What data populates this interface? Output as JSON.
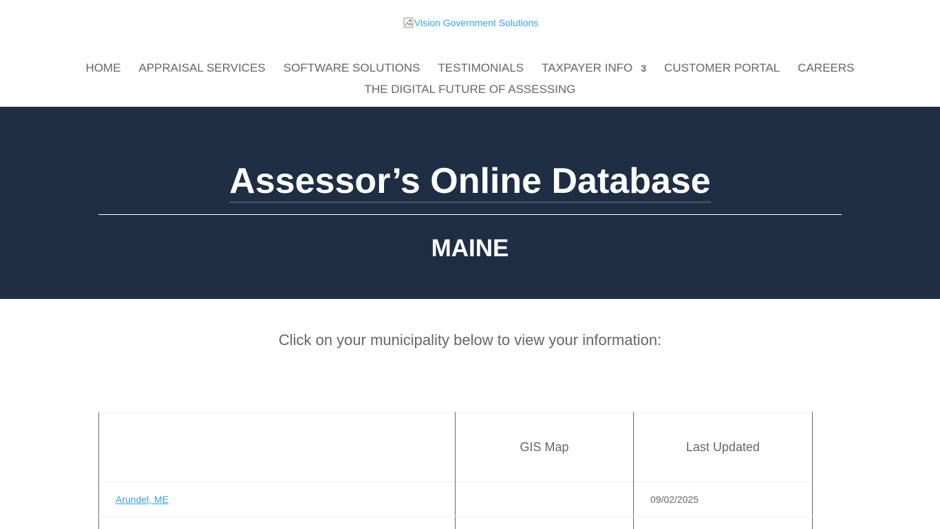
{
  "header": {
    "logo_alt": "Vision Government Solutions"
  },
  "nav": {
    "row1": [
      {
        "label": "HOME"
      },
      {
        "label": "APPRAISAL SERVICES"
      },
      {
        "label": "SOFTWARE SOLUTIONS"
      },
      {
        "label": "TESTIMONIALS"
      },
      {
        "label": "TAXPAYER INFO",
        "caret": "3"
      },
      {
        "label": "CUSTOMER PORTAL"
      },
      {
        "label": "CAREERS"
      }
    ],
    "row2": [
      {
        "label": "THE DIGITAL FUTURE OF ASSESSING"
      }
    ]
  },
  "banner": {
    "title": "Assessor’s Online Database",
    "subtitle": "MAINE",
    "background": "#1f2e44"
  },
  "main": {
    "instruction": "Click on your municipality below to view your information:"
  },
  "table": {
    "headers": [
      "",
      "GIS Map",
      "Last Updated"
    ],
    "rows": [
      {
        "municipality": "Arundel, ME",
        "gis_map": "",
        "last_updated": "09/02/2025"
      },
      {
        "municipality": "",
        "gis_map": "",
        "last_updated": ""
      }
    ]
  },
  "colors": {
    "link": "#2ea3f2",
    "text": "#666666",
    "banner": "#1f2e44"
  }
}
